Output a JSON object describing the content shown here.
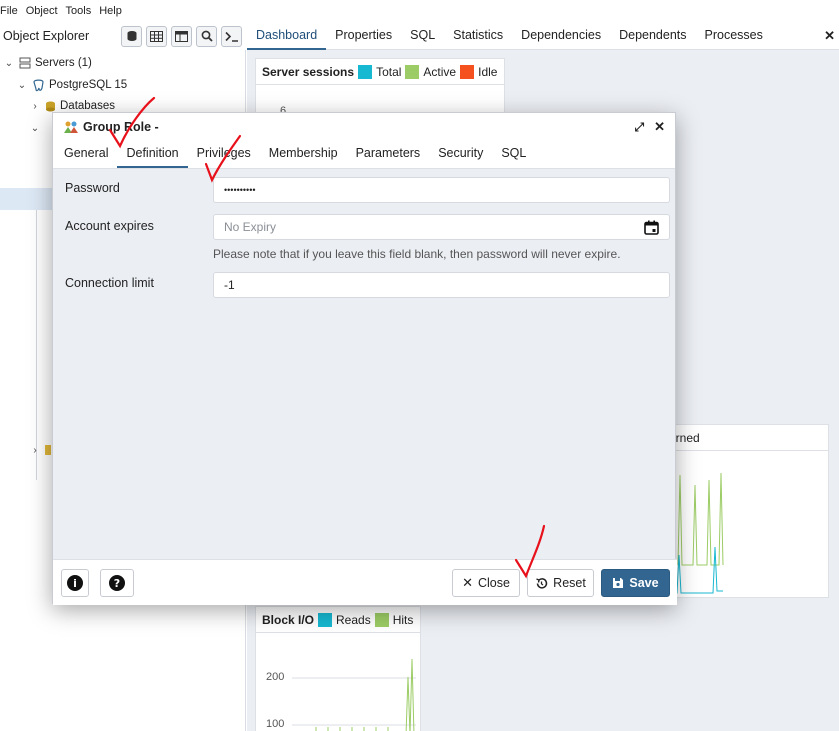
{
  "menu": {
    "items": [
      "File",
      "Object",
      "Tools",
      "Help"
    ]
  },
  "object_explorer": {
    "title": "Object Explorer",
    "tree": {
      "servers": "Servers (1)",
      "postgres": "PostgreSQL 15",
      "databases": "Databases"
    }
  },
  "main_tabs": [
    "Dashboard",
    "Properties",
    "SQL",
    "Statistics",
    "Dependencies",
    "Dependents",
    "Processes"
  ],
  "dashboard": {
    "server_sessions": {
      "title": "Server sessions",
      "legend": [
        "Total",
        "Active",
        "Idle"
      ],
      "tick": "6"
    },
    "tuples_partial": "eturned",
    "block_io": {
      "title": "Block I/O",
      "legend": [
        "Reads",
        "Hits"
      ],
      "ticks": [
        "200",
        "100"
      ]
    }
  },
  "modal": {
    "title": "Group Role -",
    "tabs": [
      "General",
      "Definition",
      "Privileges",
      "Membership",
      "Parameters",
      "Security",
      "SQL"
    ],
    "password_label": "Password",
    "password_value": "••••••••••",
    "expires_label": "Account expires",
    "expires_placeholder": "No Expiry",
    "expires_note": "Please note that if you leave this field blank, then password will never expire.",
    "conn_label": "Connection limit",
    "conn_value": "-1",
    "buttons": {
      "close": "Close",
      "reset": "Reset",
      "save": "Save"
    }
  },
  "colors": {
    "total": "#17b8d1",
    "active": "#9ccc65",
    "idle": "#f4511e",
    "primary": "#326690",
    "annotation": "#e8101a"
  }
}
